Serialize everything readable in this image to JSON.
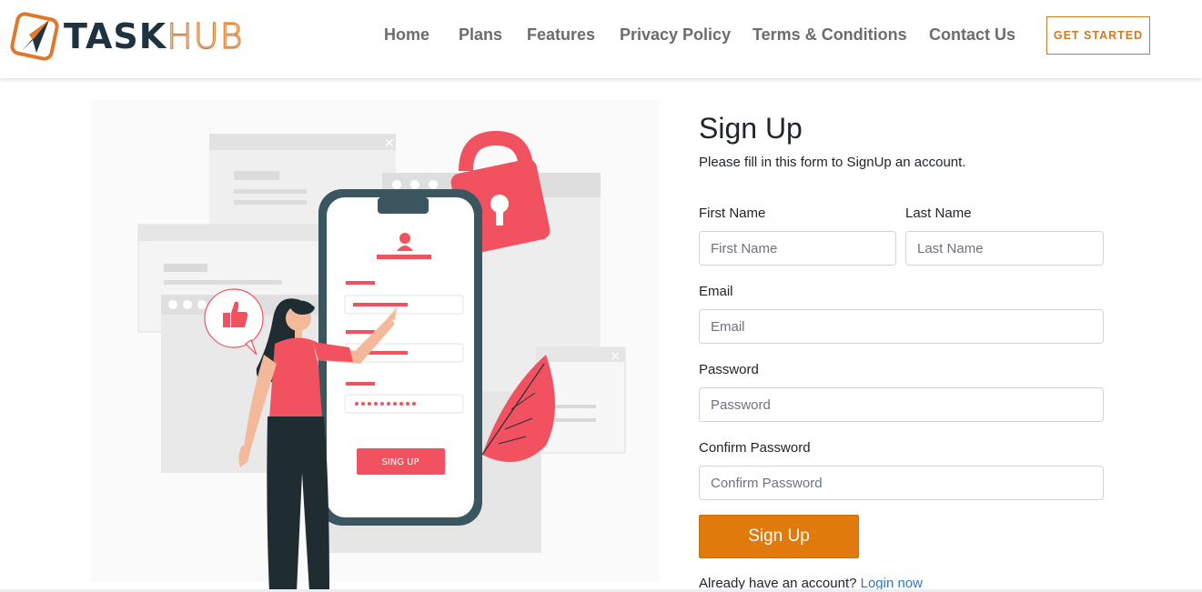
{
  "brand": {
    "name_bold": "TASK",
    "name_light": "HUB"
  },
  "nav": {
    "links": [
      "Home",
      "Plans",
      "Features",
      "Privacy Policy",
      "Terms & Conditions",
      "Contact Us"
    ],
    "cta": "GET STARTED"
  },
  "illustration": {
    "button_text": "SING UP"
  },
  "form": {
    "title": "Sign Up",
    "subtitle": "Please fill in this form to SignUp an account.",
    "first_name": {
      "label": "First Name",
      "placeholder": "First Name"
    },
    "last_name": {
      "label": "Last Name",
      "placeholder": "Last Name"
    },
    "email": {
      "label": "Email",
      "placeholder": "Email"
    },
    "password": {
      "label": "Password",
      "placeholder": "Password"
    },
    "confirm_password": {
      "label": "Confirm Password",
      "placeholder": "Confirm Password"
    },
    "submit": "Sign Up",
    "login_prompt": "Already have an account?",
    "login_link": "Login now"
  },
  "colors": {
    "accent": "#e07a0c",
    "navy": "#1f3240",
    "pink": "#f2525f",
    "link": "#2b78c5"
  }
}
